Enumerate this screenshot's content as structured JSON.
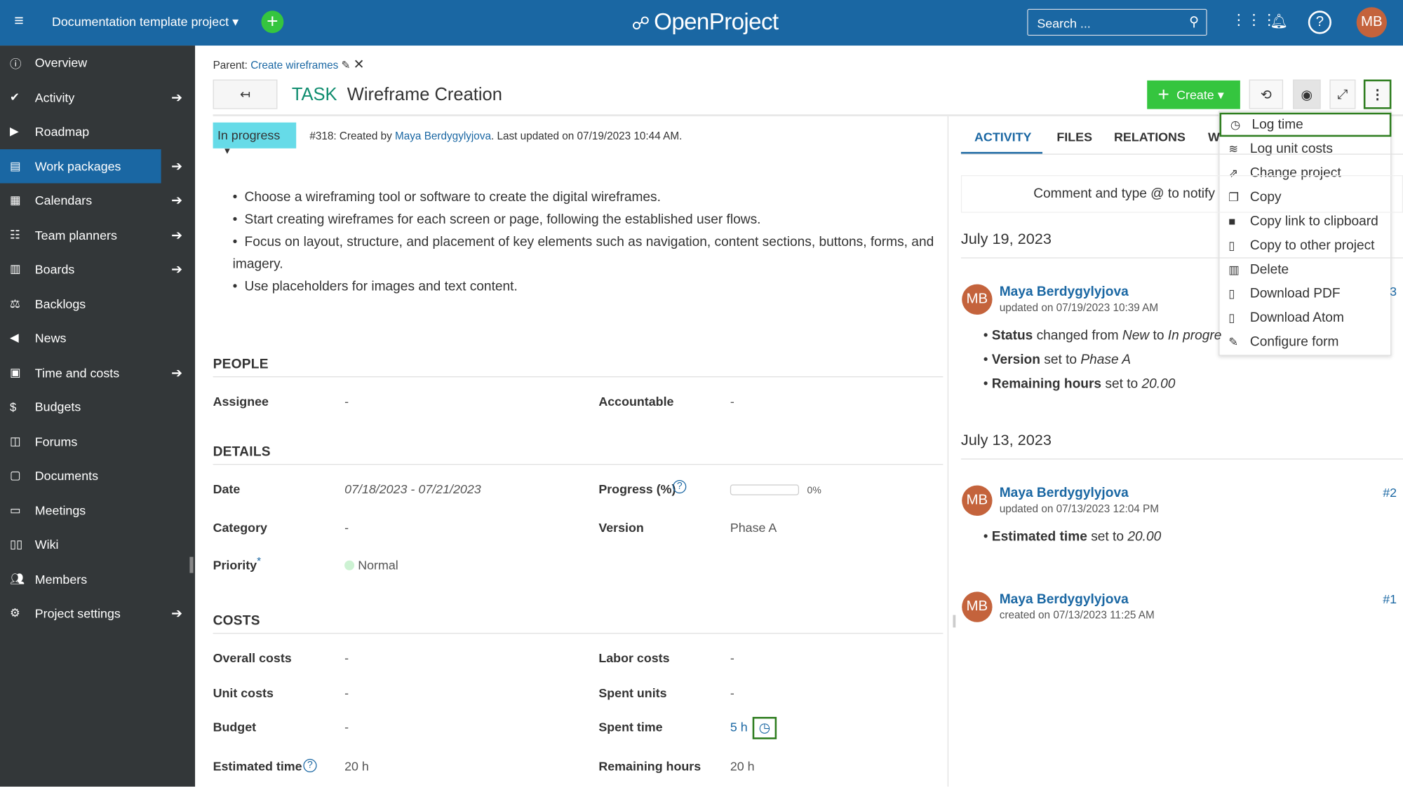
{
  "header": {
    "project": "Documentation template project",
    "logo": "OpenProject",
    "search_placeholder": "Search ...",
    "avatar": "MB",
    "colors": {
      "bar": "#1a67a3",
      "add": "#35c53f"
    }
  },
  "sidebar": {
    "items": [
      {
        "label": "Overview",
        "icon": "info-icon",
        "arrow": false
      },
      {
        "label": "Activity",
        "icon": "check-icon",
        "arrow": true
      },
      {
        "label": "Roadmap",
        "icon": "tag-icon",
        "arrow": false
      },
      {
        "label": "Work packages",
        "icon": "work-packages-icon",
        "arrow": true,
        "active": true
      },
      {
        "label": "Calendars",
        "icon": "calendar-icon",
        "arrow": true
      },
      {
        "label": "Team planners",
        "icon": "team-planner-icon",
        "arrow": true
      },
      {
        "label": "Boards",
        "icon": "boards-icon",
        "arrow": true
      },
      {
        "label": "Backlogs",
        "icon": "backlogs-icon",
        "arrow": false
      },
      {
        "label": "News",
        "icon": "megaphone-icon",
        "arrow": false
      },
      {
        "label": "Time and costs",
        "icon": "time-costs-icon",
        "arrow": true
      },
      {
        "label": "Budgets",
        "icon": "budget-icon",
        "arrow": false
      },
      {
        "label": "Forums",
        "icon": "forums-icon",
        "arrow": false
      },
      {
        "label": "Documents",
        "icon": "documents-icon",
        "arrow": false
      },
      {
        "label": "Meetings",
        "icon": "meetings-icon",
        "arrow": false
      },
      {
        "label": "Wiki",
        "icon": "wiki-icon",
        "arrow": false
      },
      {
        "label": "Members",
        "icon": "members-icon",
        "arrow": false
      },
      {
        "label": "Project settings",
        "icon": "settings-icon",
        "arrow": true
      }
    ]
  },
  "wp": {
    "parent_label": "Parent:",
    "parent_link": "Create wireframes",
    "type": "TASK",
    "title": "Wireframe Creation",
    "status": "In progress",
    "meta_prefix": "#318: Created by ",
    "meta_author": "Maya Berdygylyjova",
    "meta_suffix": ". Last updated on 07/19/2023 10:44 AM.",
    "create_label": "Create",
    "description": [
      "Choose a wireframing tool or software to create the digital wireframes.",
      "Start creating wireframes for each screen or page, following the established user flows.",
      "Focus on layout, structure, and placement of key elements such as navigation, content sections, buttons, forms, and imagery.",
      "Use placeholders for images and text content."
    ],
    "people": {
      "title": "PEOPLE",
      "assignee_label": "Assignee",
      "assignee": "-",
      "accountable_label": "Accountable",
      "accountable": "-"
    },
    "details": {
      "title": "DETAILS",
      "date_label": "Date",
      "date": "07/18/2023 - 07/21/2023",
      "progress_label": "Progress (%)",
      "progress": 0,
      "progress_text": "0%",
      "category_label": "Category",
      "category": "-",
      "version_label": "Version",
      "version": "Phase A",
      "priority_label": "Priority",
      "priority_req": "*",
      "priority": "Normal"
    },
    "costs": {
      "title": "COSTS",
      "overall_label": "Overall costs",
      "overall": "-",
      "labor_label": "Labor costs",
      "labor": "-",
      "unit_label": "Unit costs",
      "unit": "-",
      "spent_units_label": "Spent units",
      "spent_units": "-",
      "budget_label": "Budget",
      "budget": "-",
      "spent_time_label": "Spent time",
      "spent_time": "5 h",
      "est_label": "Estimated time",
      "est": "20 h",
      "remaining_label": "Remaining hours",
      "remaining": "20 h"
    }
  },
  "panel": {
    "tabs": [
      "ACTIVITY",
      "FILES",
      "RELATIONS",
      "W"
    ],
    "comment_placeholder": "Comment and type @ to notify",
    "days": [
      {
        "date": "July 19, 2023",
        "entries": [
          {
            "avatar": "MB",
            "author": "Maya Berdygylyjova",
            "time": "updated on 07/19/2023 10:39 AM",
            "num": "3",
            "changes": [
              [
                "Status",
                " changed from ",
                "New",
                " to ",
                "In progre"
              ],
              [
                "Version",
                " set to ",
                "Phase A"
              ],
              [
                "Remaining hours",
                " set to ",
                "20.00"
              ]
            ]
          }
        ]
      },
      {
        "date": "July 13, 2023",
        "entries": [
          {
            "avatar": "MB",
            "author": "Maya Berdygylyjova",
            "time": "updated on 07/13/2023 12:04 PM",
            "num": "#2",
            "changes": [
              [
                "Estimated time",
                " set to ",
                "20.00"
              ]
            ]
          },
          {
            "avatar": "MB",
            "author": "Maya Berdygylyjova",
            "time": "created on 07/13/2023 11:25 AM",
            "num": "#1",
            "changes": []
          }
        ]
      }
    ]
  },
  "menu": {
    "items": [
      {
        "label": "Log time",
        "icon": "clock-icon",
        "g": "◷"
      },
      {
        "label": "Log unit costs",
        "icon": "layers-icon",
        "g": "≋"
      },
      {
        "label": "Change project",
        "icon": "move-icon",
        "g": "⇗"
      },
      {
        "label": "Copy",
        "icon": "copy-icon",
        "g": "❐"
      },
      {
        "label": "Copy link to clipboard",
        "icon": "clipboard-icon",
        "g": "■"
      },
      {
        "label": "Copy to other project",
        "icon": "copy-project-icon",
        "g": "▯"
      },
      {
        "label": "Delete",
        "icon": "trash-icon",
        "g": "▥"
      },
      {
        "label": "Download PDF",
        "icon": "pdf-icon",
        "g": "▯"
      },
      {
        "label": "Download Atom",
        "icon": "atom-icon",
        "g": "▯"
      },
      {
        "label": "Configure form",
        "icon": "wrench-icon",
        "g": "✎"
      }
    ]
  }
}
